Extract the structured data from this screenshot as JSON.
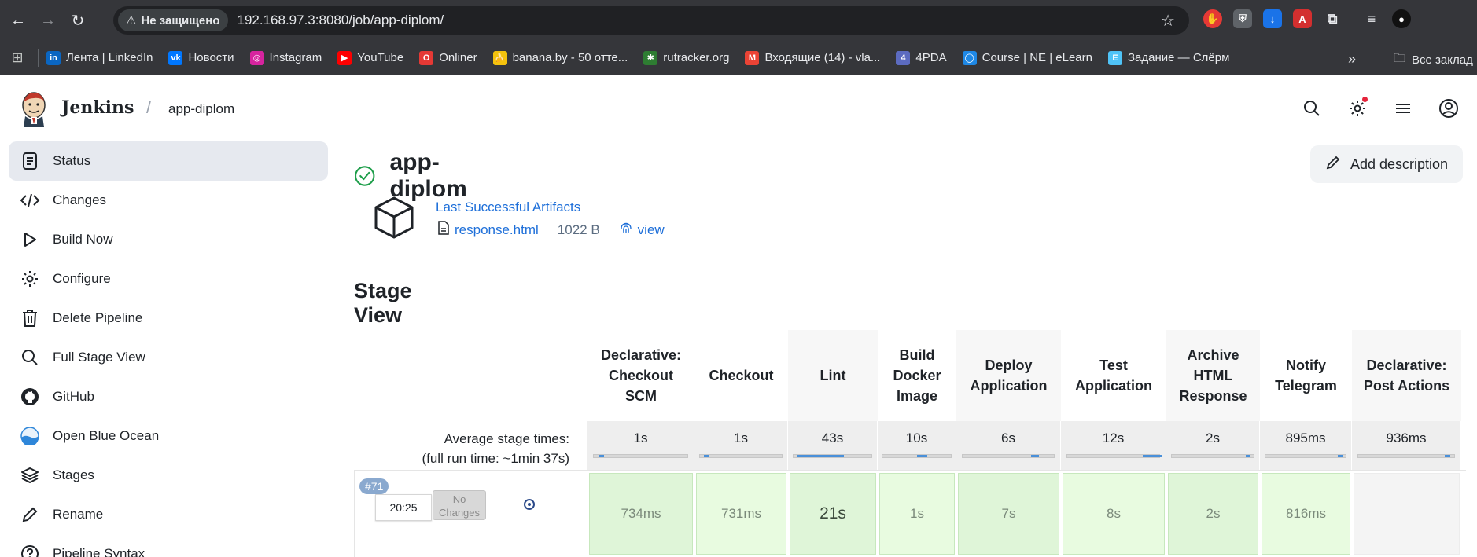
{
  "browser": {
    "security_label": "Не защищено",
    "url": "192.168.97.3:8080/job/app-diplom/",
    "bookmarks": [
      {
        "label": "Лента | LinkedIn",
        "icon": "linkedin-icon",
        "color": "#0a66c2",
        "glyph": "in"
      },
      {
        "label": "Новости",
        "icon": "vk-icon",
        "color": "#0077ff",
        "glyph": "vk"
      },
      {
        "label": "Instagram",
        "icon": "instagram-icon",
        "color": "#d6249f",
        "glyph": "◎"
      },
      {
        "label": "YouTube",
        "icon": "youtube-icon",
        "color": "#ff0000",
        "glyph": "▶"
      },
      {
        "label": "Onliner",
        "icon": "onliner-icon",
        "color": "#e53935",
        "glyph": "O"
      },
      {
        "label": "banana.by - 50 отте...",
        "icon": "banana-icon",
        "color": "#f4c20d",
        "glyph": "🍌"
      },
      {
        "label": "rutracker.org",
        "icon": "rutracker-icon",
        "color": "#2e7d32",
        "glyph": "✱"
      },
      {
        "label": "Входящие (14) - vla...",
        "icon": "gmail-icon",
        "color": "#ea4335",
        "glyph": "M"
      },
      {
        "label": "4PDA",
        "icon": "4pda-icon",
        "color": "#5c6bc0",
        "glyph": "4"
      },
      {
        "label": "Course | NE | eLearn",
        "icon": "course-icon",
        "color": "#1e88e5",
        "glyph": "◯"
      },
      {
        "label": "Задание — Слёрм",
        "icon": "slurm-icon",
        "color": "#4fc3f7",
        "glyph": "E"
      }
    ],
    "all_bookmarks_label": "Все заклад"
  },
  "header": {
    "brand": "Jenkins",
    "breadcrumb": "app-diplom"
  },
  "sidebar": {
    "items": [
      {
        "label": "Status",
        "icon": "status-icon"
      },
      {
        "label": "Changes",
        "icon": "code-icon"
      },
      {
        "label": "Build Now",
        "icon": "play-icon"
      },
      {
        "label": "Configure",
        "icon": "gear-icon"
      },
      {
        "label": "Delete Pipeline",
        "icon": "trash-icon"
      },
      {
        "label": "Full Stage View",
        "icon": "search-icon"
      },
      {
        "label": "GitHub",
        "icon": "github-icon"
      },
      {
        "label": "Open Blue Ocean",
        "icon": "blue-ocean-icon"
      },
      {
        "label": "Stages",
        "icon": "layers-icon"
      },
      {
        "label": "Rename",
        "icon": "pencil-icon"
      },
      {
        "label": "Pipeline Syntax",
        "icon": "help-icon"
      }
    ]
  },
  "main": {
    "title": "app-diplom",
    "add_description": "Add description",
    "artifacts": {
      "title": "Last Successful Artifacts",
      "file": "response.html",
      "size": "1022 B",
      "view": "view"
    },
    "stage_view_title": "Stage View"
  },
  "stage_view": {
    "avg_label_line1": "Average stage times:",
    "avg_label_full": "full",
    "avg_label_rest": " run time: ~1min 37s)",
    "avg_label_open": "(",
    "stages": [
      {
        "name": "Declarative: Checkout SCM",
        "avg": "1s",
        "run": "734ms",
        "avg_fraction": 0.02
      },
      {
        "name": "Checkout",
        "avg": "1s",
        "run": "731ms",
        "avg_fraction": 0.02
      },
      {
        "name": "Lint",
        "avg": "43s",
        "run": "21s",
        "avg_fraction": 0.6
      },
      {
        "name": "Build Docker Image",
        "avg": "10s",
        "run": "1s",
        "avg_fraction": 0.15
      },
      {
        "name": "Deploy Application",
        "avg": "6s",
        "run": "7s",
        "avg_fraction": 0.08
      },
      {
        "name": "Test Application",
        "avg": "12s",
        "run": "8s",
        "avg_fraction": 0.2
      },
      {
        "name": "Archive HTML Response",
        "avg": "2s",
        "run": "2s",
        "avg_fraction": 0.03
      },
      {
        "name": "Notify Telegram",
        "avg": "895ms",
        "run": "816ms",
        "avg_fraction": 0.01
      },
      {
        "name": "Declarative: Post Actions",
        "avg": "936ms",
        "run": "",
        "avg_fraction": 0.01
      }
    ],
    "build": {
      "number": "#71",
      "time": "20:25",
      "changes": "No Changes"
    }
  }
}
